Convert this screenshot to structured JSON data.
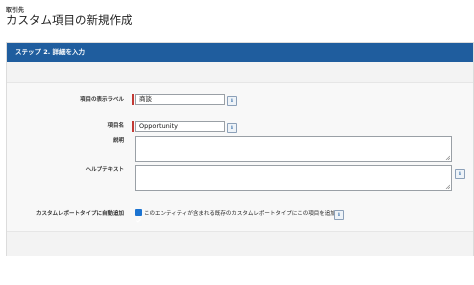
{
  "breadcrumb": "取引先",
  "page_title": "カスタム項目の新規作成",
  "step_header": "ステップ 2. 詳細を入力",
  "fields": {
    "label": {
      "label": "項目の表示ラベル",
      "value": "商談"
    },
    "api_name": {
      "label": "項目名",
      "value": "Opportunity"
    },
    "description": {
      "label": "説明",
      "value": ""
    },
    "help_text": {
      "label": "ヘルプテキスト",
      "value": ""
    },
    "report_type": {
      "label": "カスタムレポートタイプに自動追加",
      "checkbox_text": "このエンティティが含まれる既存のカスタムレポートタイプにこの項目を追加",
      "checked": true
    }
  },
  "info_icon_glyph": "i",
  "colors": {
    "header_blue": "#1f5d9e",
    "required_red": "#c23934",
    "checkbox_blue": "#1b73d1"
  }
}
